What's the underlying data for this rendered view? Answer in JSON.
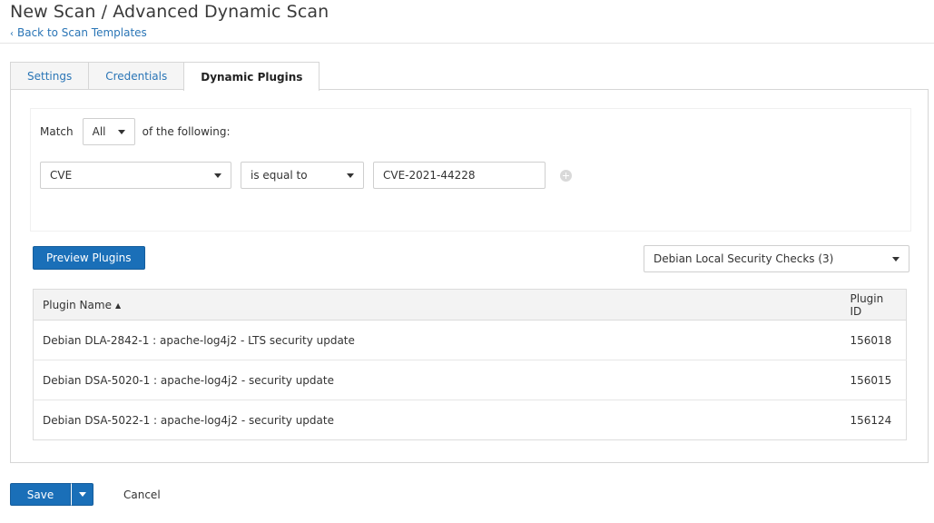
{
  "header": {
    "title": "New Scan / Advanced Dynamic Scan",
    "back_link": "Back to Scan Templates"
  },
  "tabs": [
    {
      "label": "Settings",
      "active": false
    },
    {
      "label": "Credentials",
      "active": false
    },
    {
      "label": "Dynamic Plugins",
      "active": true
    }
  ],
  "rules": {
    "match_prefix": "Match",
    "match_value": "All",
    "match_suffix": "of the following:",
    "condition": {
      "field": "CVE",
      "operator": "is equal to",
      "value": "CVE-2021-44228"
    }
  },
  "preview_button": "Preview Plugins",
  "family_select": "Debian Local Security Checks (3)",
  "table": {
    "columns": [
      "Plugin Name",
      "Plugin ID"
    ],
    "sort_indicator": "▲",
    "rows": [
      {
        "name": "Debian DLA-2842-1 : apache-log4j2 - LTS security update",
        "id": "156018"
      },
      {
        "name": "Debian DSA-5020-1 : apache-log4j2 - security update",
        "id": "156015"
      },
      {
        "name": "Debian DSA-5022-1 : apache-log4j2 - security update",
        "id": "156124"
      }
    ]
  },
  "footer": {
    "save_label": "Save",
    "cancel_label": "Cancel"
  },
  "icons": {
    "back": "chevron-left-icon",
    "add_condition": "plus-circle-icon",
    "dropdown": "caret-down-icon"
  },
  "colors": {
    "primary": "#1a6fb8",
    "link": "#2a75b6"
  }
}
